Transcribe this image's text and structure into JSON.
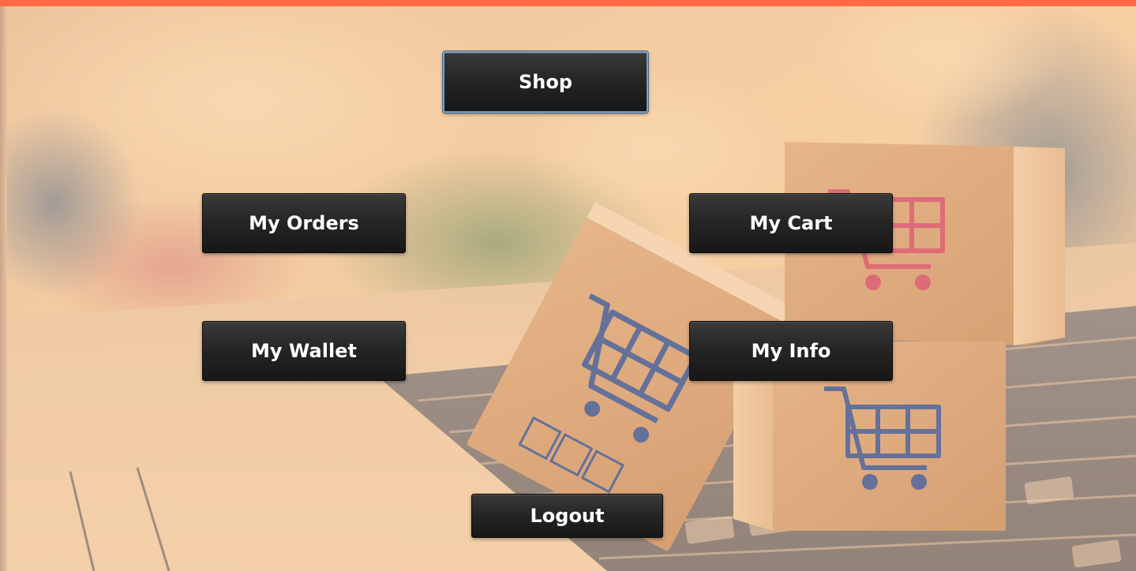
{
  "colors": {
    "top_bar": "#ff6a45",
    "button_bg": "#262626",
    "button_text": "#ffffff",
    "focus_border": "#7e9fbf"
  },
  "background": {
    "description_icon": "shopping-cart-boxes-on-laptop-image"
  },
  "menu": {
    "shop_label": "Shop",
    "orders_label": "My Orders",
    "cart_label": "My Cart",
    "wallet_label": "My Wallet",
    "info_label": "My Info",
    "logout_label": "Logout"
  }
}
